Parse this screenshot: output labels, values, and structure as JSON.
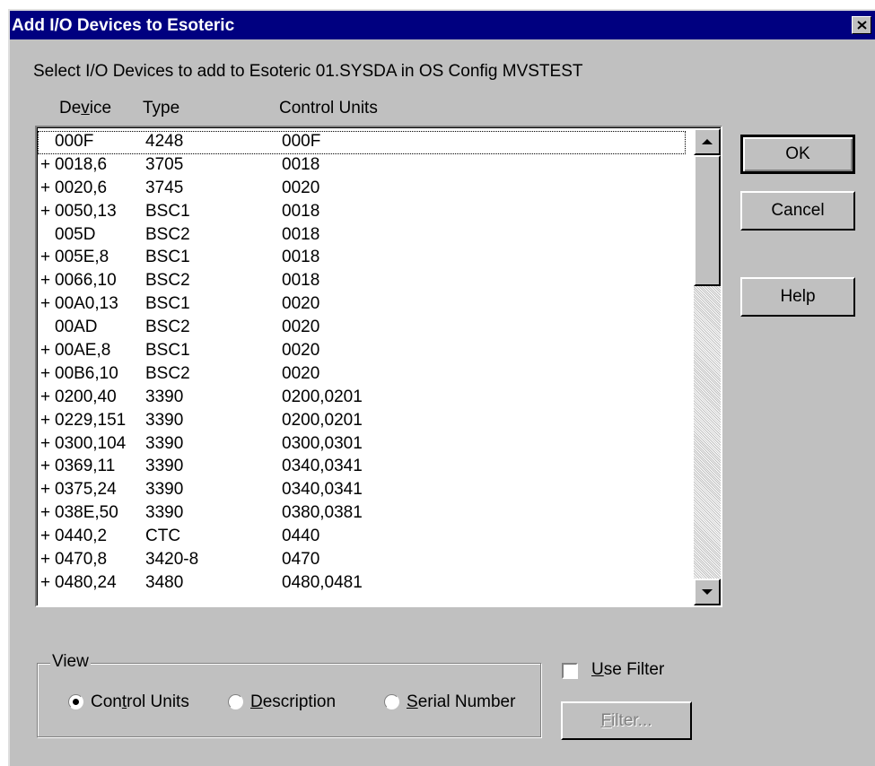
{
  "window": {
    "title": "Add I/O Devices to Esoteric"
  },
  "prompt": "Select I/O Devices to add to Esoteric 01.SYSDA in OS Config MVSTEST",
  "columns": {
    "device": "Device",
    "type": "Type",
    "control_units": "Control Units"
  },
  "rows": [
    {
      "plus": "",
      "device": "000F",
      "type": "4248",
      "cu": "000F"
    },
    {
      "plus": "+",
      "device": "0018,6",
      "type": "3705",
      "cu": "0018"
    },
    {
      "plus": "+",
      "device": "0020,6",
      "type": "3745",
      "cu": "0020"
    },
    {
      "plus": "+",
      "device": "0050,13",
      "type": "BSC1",
      "cu": "0018"
    },
    {
      "plus": "",
      "device": "005D",
      "type": "BSC2",
      "cu": "0018"
    },
    {
      "plus": "+",
      "device": "005E,8",
      "type": "BSC1",
      "cu": "0018"
    },
    {
      "plus": "+",
      "device": "0066,10",
      "type": "BSC2",
      "cu": "0018"
    },
    {
      "plus": "+",
      "device": "00A0,13",
      "type": "BSC1",
      "cu": "0020"
    },
    {
      "plus": "",
      "device": "00AD",
      "type": "BSC2",
      "cu": "0020"
    },
    {
      "plus": "+",
      "device": "00AE,8",
      "type": "BSC1",
      "cu": "0020"
    },
    {
      "plus": "+",
      "device": "00B6,10",
      "type": "BSC2",
      "cu": "0020"
    },
    {
      "plus": "+",
      "device": "0200,40",
      "type": "3390",
      "cu": "0200,0201"
    },
    {
      "plus": "+",
      "device": "0229,151",
      "type": "3390",
      "cu": "0200,0201"
    },
    {
      "plus": "+",
      "device": "0300,104",
      "type": "3390",
      "cu": "0300,0301"
    },
    {
      "plus": "+",
      "device": "0369,11",
      "type": "3390",
      "cu": "0340,0341"
    },
    {
      "plus": "+",
      "device": "0375,24",
      "type": "3390",
      "cu": "0340,0341"
    },
    {
      "plus": "+",
      "device": "038E,50",
      "type": "3390",
      "cu": "0380,0381"
    },
    {
      "plus": "+",
      "device": "0440,2",
      "type": "CTC",
      "cu": "0440"
    },
    {
      "plus": "+",
      "device": "0470,8",
      "type": "3420-8",
      "cu": "0470"
    },
    {
      "plus": "+",
      "device": "0480,24",
      "type": "3480",
      "cu": "0480,0481"
    }
  ],
  "buttons": {
    "ok": "OK",
    "cancel": "Cancel",
    "help": "Help",
    "filter": "Filter..."
  },
  "view_group": {
    "label": "View",
    "options": [
      "Control Units",
      "Description",
      "Serial Number"
    ],
    "selected": "Control Units"
  },
  "use_filter": {
    "label": "Use Filter",
    "checked": false
  },
  "colors": {
    "face": "#c0c0c0",
    "titlebar": "#000080"
  }
}
